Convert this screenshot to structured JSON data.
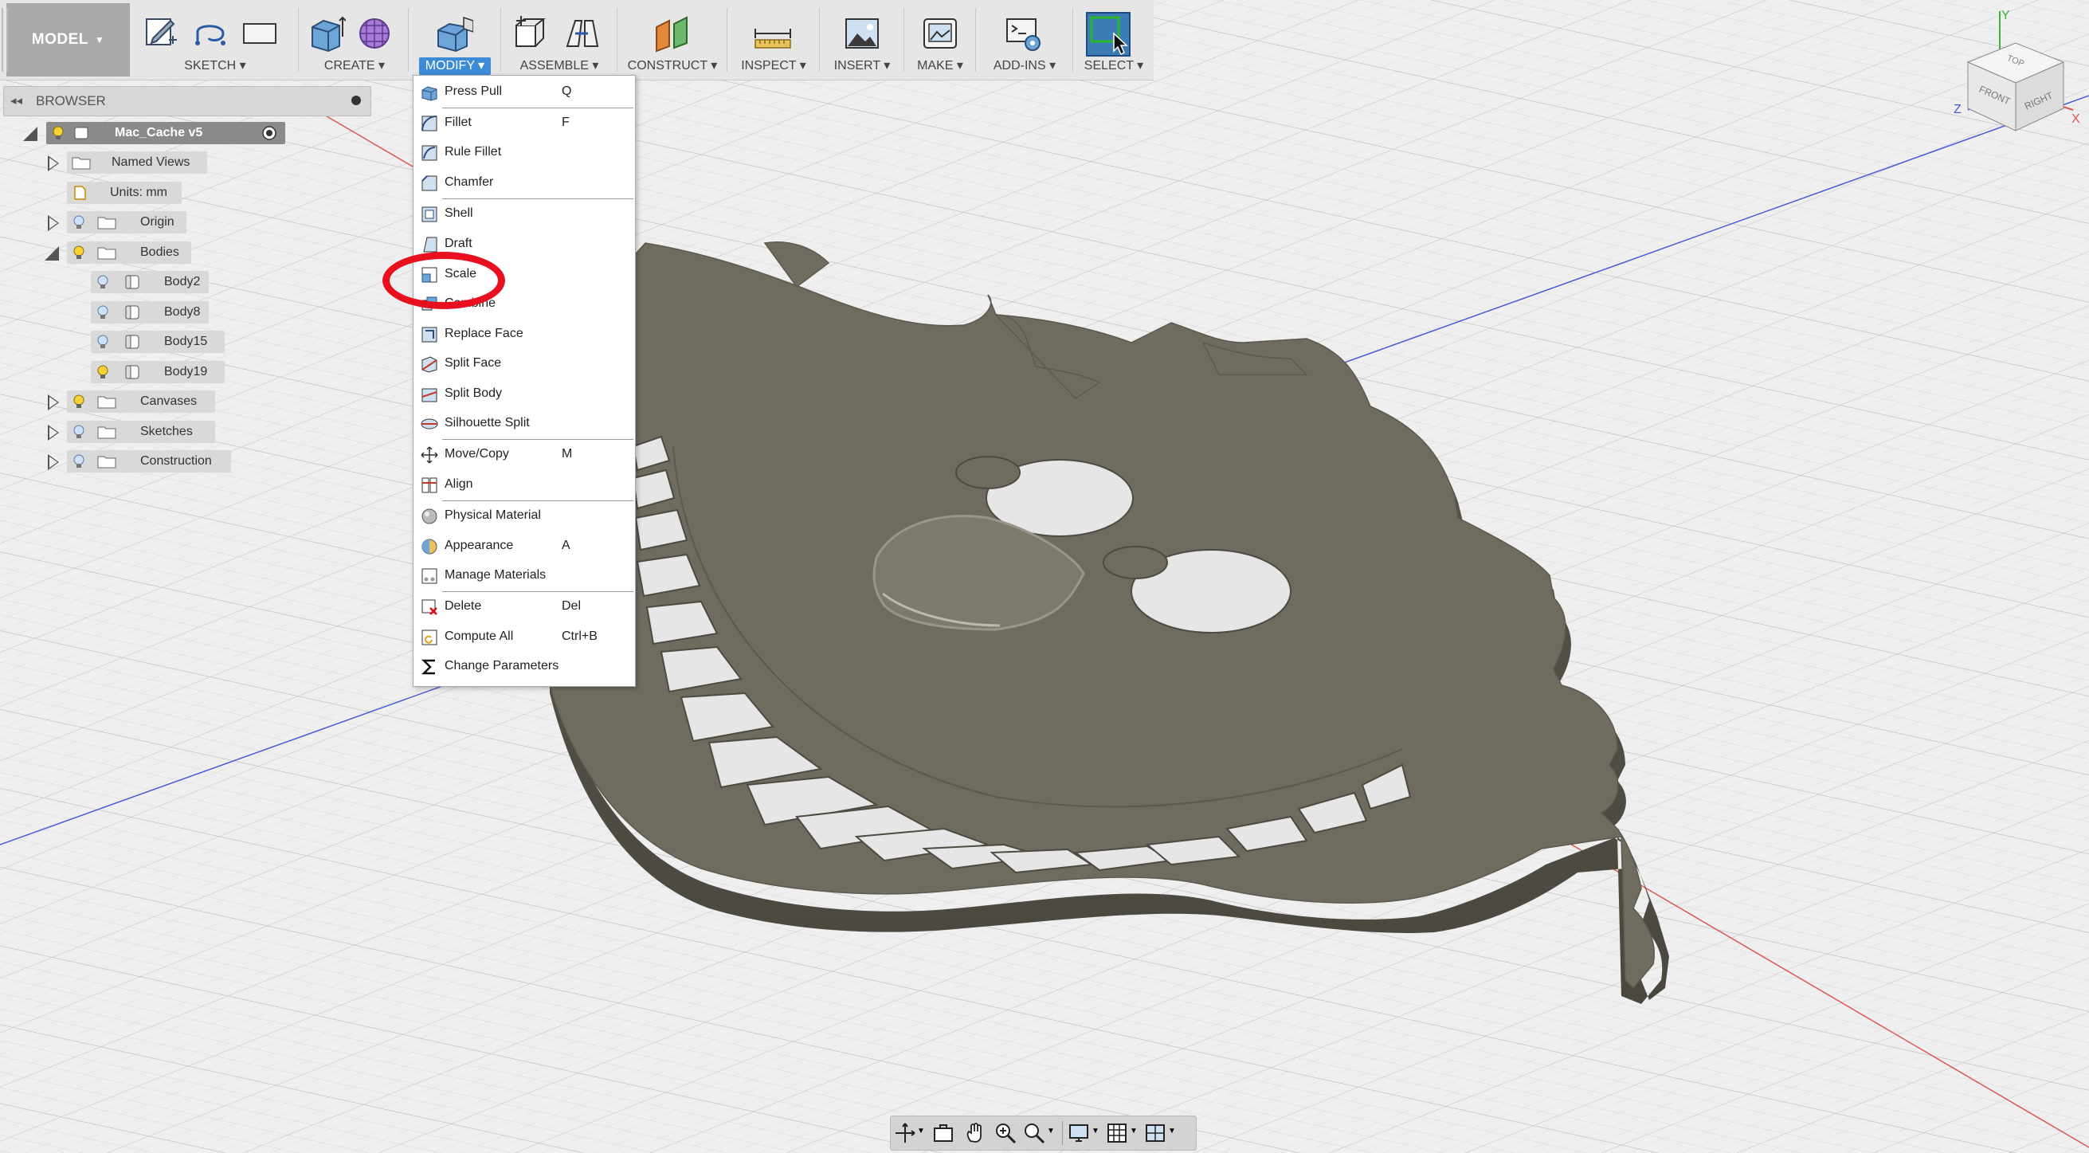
{
  "toolbar": {
    "workspace": "MODEL",
    "groups": [
      {
        "label": "SKETCH"
      },
      {
        "label": "CREATE"
      },
      {
        "label": "MODIFY"
      },
      {
        "label": "ASSEMBLE"
      },
      {
        "label": "CONSTRUCT"
      },
      {
        "label": "INSPECT"
      },
      {
        "label": "INSERT"
      },
      {
        "label": "MAKE"
      },
      {
        "label": "ADD-INS"
      },
      {
        "label": "SELECT"
      }
    ],
    "active_group": "MODIFY",
    "accent_color": "#3b8bd6"
  },
  "browser": {
    "title": "BROWSER",
    "root": "Mac_Cache v5",
    "items": [
      {
        "label": "Named Views"
      },
      {
        "label": "Units: mm"
      },
      {
        "label": "Origin"
      },
      {
        "label": "Bodies"
      },
      {
        "label": "Body2"
      },
      {
        "label": "Body8"
      },
      {
        "label": "Body15"
      },
      {
        "label": "Body19"
      },
      {
        "label": "Canvases"
      },
      {
        "label": "Sketches"
      },
      {
        "label": "Construction"
      }
    ]
  },
  "modify_menu": {
    "items": [
      {
        "label": "Press Pull",
        "shortcut": "Q"
      },
      {
        "label": "Fillet",
        "shortcut": "F"
      },
      {
        "label": "Rule Fillet",
        "shortcut": ""
      },
      {
        "label": "Chamfer",
        "shortcut": ""
      },
      {
        "label": "Shell",
        "shortcut": ""
      },
      {
        "label": "Draft",
        "shortcut": ""
      },
      {
        "label": "Scale",
        "shortcut": ""
      },
      {
        "label": "Combine",
        "shortcut": ""
      },
      {
        "label": "Replace Face",
        "shortcut": ""
      },
      {
        "label": "Split Face",
        "shortcut": ""
      },
      {
        "label": "Split Body",
        "shortcut": ""
      },
      {
        "label": "Silhouette Split",
        "shortcut": ""
      },
      {
        "label": "Move/Copy",
        "shortcut": "M"
      },
      {
        "label": "Align",
        "shortcut": ""
      },
      {
        "label": "Physical Material",
        "shortcut": ""
      },
      {
        "label": "Appearance",
        "shortcut": "A"
      },
      {
        "label": "Manage Materials",
        "shortcut": ""
      },
      {
        "label": "Delete",
        "shortcut": "Del"
      },
      {
        "label": "Compute All",
        "shortcut": "Ctrl+B"
      },
      {
        "label": "Change Parameters",
        "shortcut": ""
      }
    ],
    "highlighted_item": "Scale",
    "highlight_color": "#e8101e"
  },
  "viewcube": {
    "faces": [
      "TOP",
      "FRONT",
      "RIGHT"
    ],
    "axes": [
      "X",
      "Y",
      "Z"
    ]
  },
  "model_color": "#6e6a5e"
}
